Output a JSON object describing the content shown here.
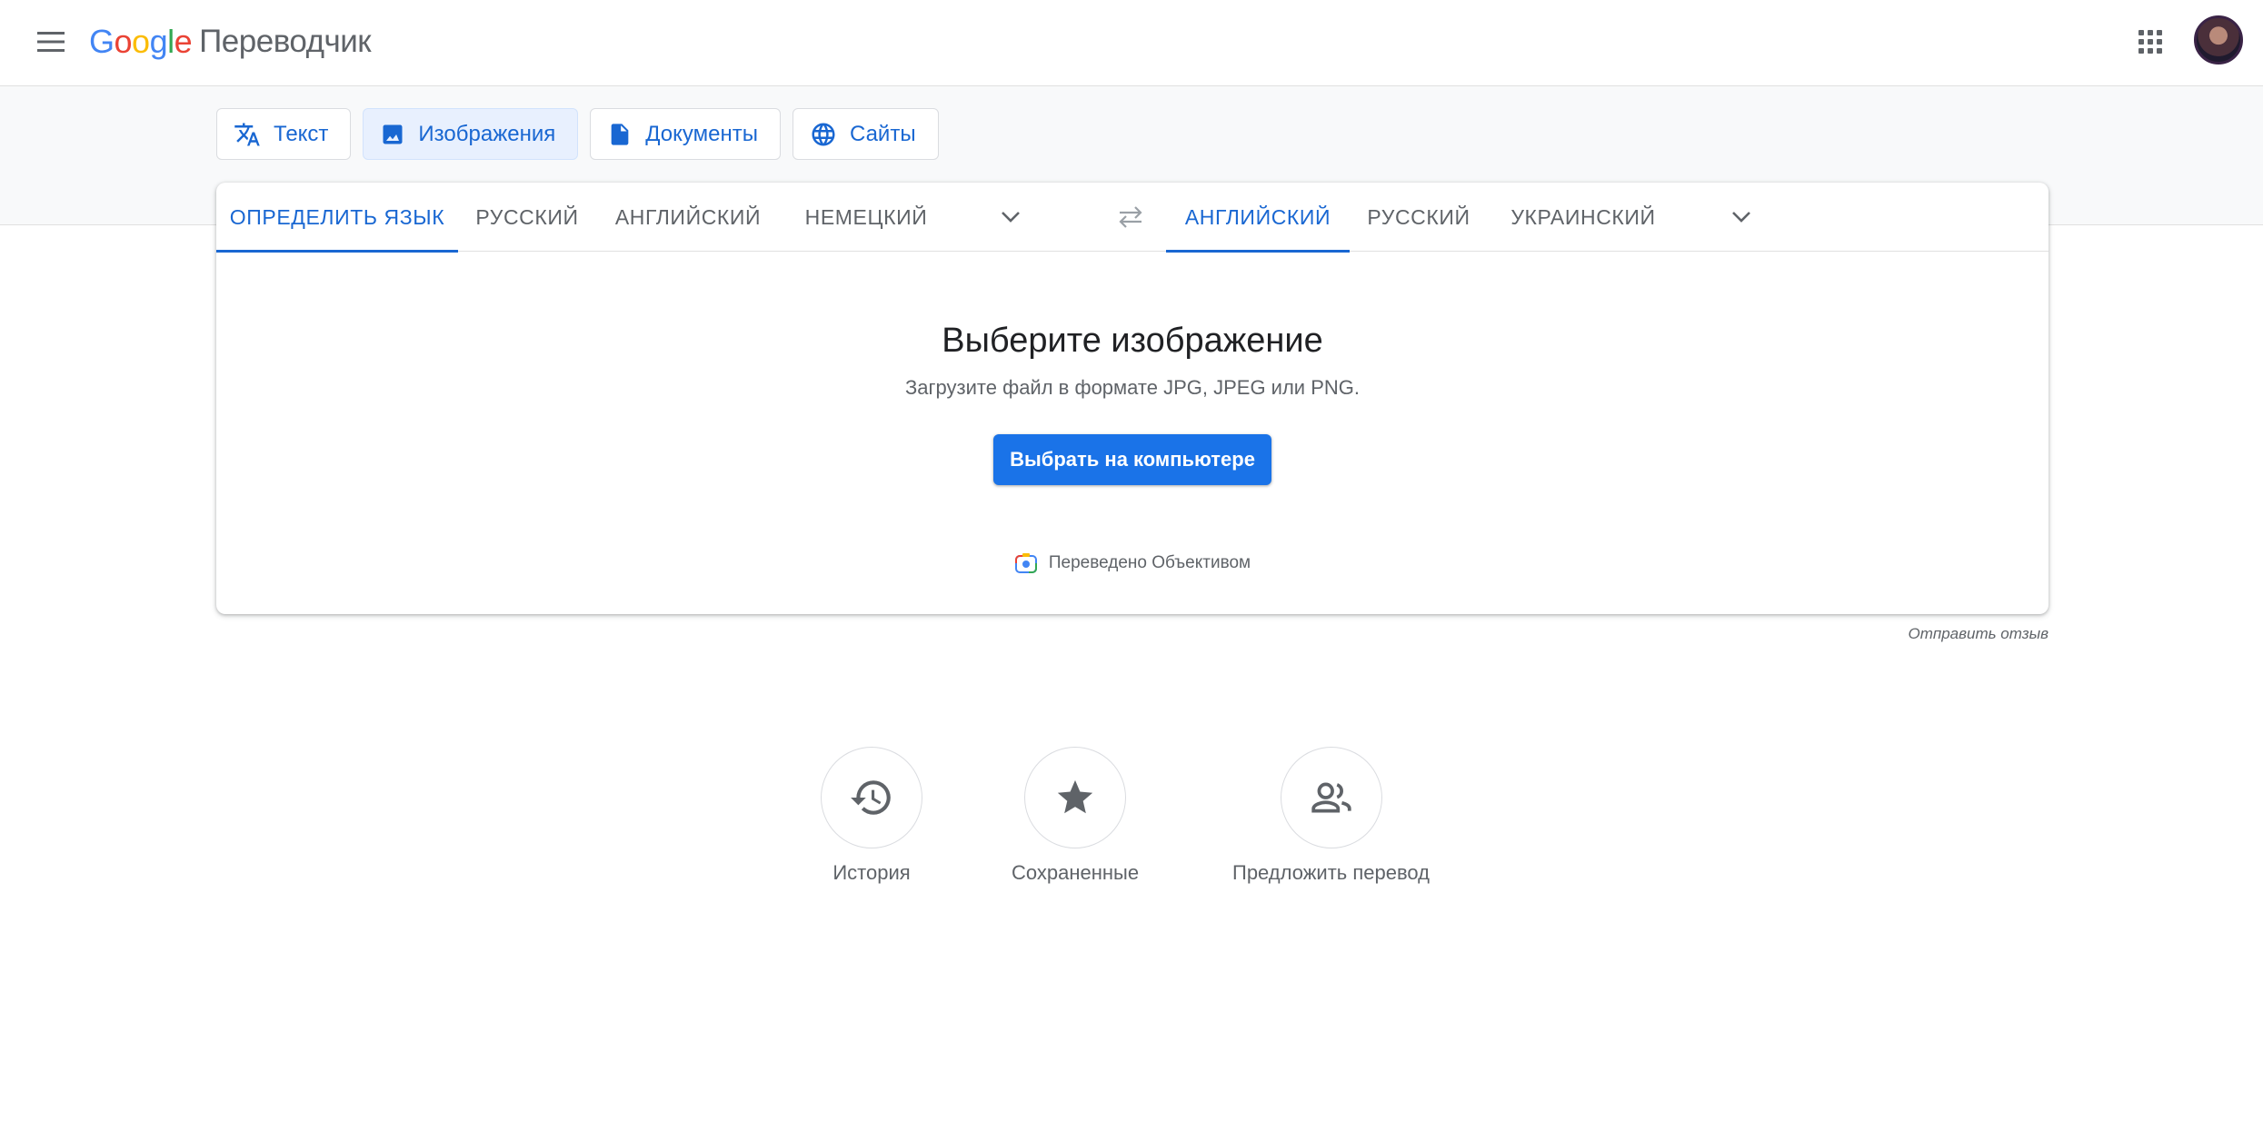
{
  "header": {
    "logo_letters": [
      "G",
      "o",
      "o",
      "g",
      "l",
      "e"
    ],
    "logo_colors": [
      "#4285F4",
      "#EA4335",
      "#FBBC05",
      "#4285F4",
      "#34A853",
      "#EA4335"
    ],
    "product_name": "Переводчик",
    "icons": {
      "menu": "menu-icon",
      "apps": "apps-grid-icon",
      "avatar": "avatar"
    }
  },
  "modes": [
    {
      "id": "text",
      "label": "Текст",
      "icon": "translate-icon",
      "active": false
    },
    {
      "id": "images",
      "label": "Изображения",
      "icon": "image-icon",
      "active": true
    },
    {
      "id": "documents",
      "label": "Документы",
      "icon": "document-icon",
      "active": false
    },
    {
      "id": "sites",
      "label": "Сайты",
      "icon": "globe-icon",
      "active": false
    }
  ],
  "source_languages": [
    {
      "label": "Определить язык",
      "active": true
    },
    {
      "label": "Русский",
      "active": false
    },
    {
      "label": "Английский",
      "active": false
    },
    {
      "label": "Немецкий",
      "active": false
    }
  ],
  "target_languages": [
    {
      "label": "Английский",
      "active": true
    },
    {
      "label": "Русский",
      "active": false
    },
    {
      "label": "Украинский",
      "active": false
    }
  ],
  "upload": {
    "title": "Выберите изображение",
    "subtitle": "Загрузите файл в формате JPG, JPEG или PNG.",
    "button_label": "Выбрать на компьютере",
    "lens_note": "Переведено Объективом"
  },
  "feedback_label": "Отправить отзыв",
  "shortcuts": [
    {
      "id": "history",
      "label": "История",
      "icon": "history-icon"
    },
    {
      "id": "saved",
      "label": "Сохраненные",
      "icon": "star-icon"
    },
    {
      "id": "contribute",
      "label": "Предложить перевод",
      "icon": "people-icon"
    }
  ],
  "colors": {
    "accent_blue": "#1967d2",
    "button_blue": "#1a73e8",
    "active_tab_bg": "#e8f0fe",
    "band_bg": "#f8f9fa",
    "text_secondary": "#5f6368"
  }
}
